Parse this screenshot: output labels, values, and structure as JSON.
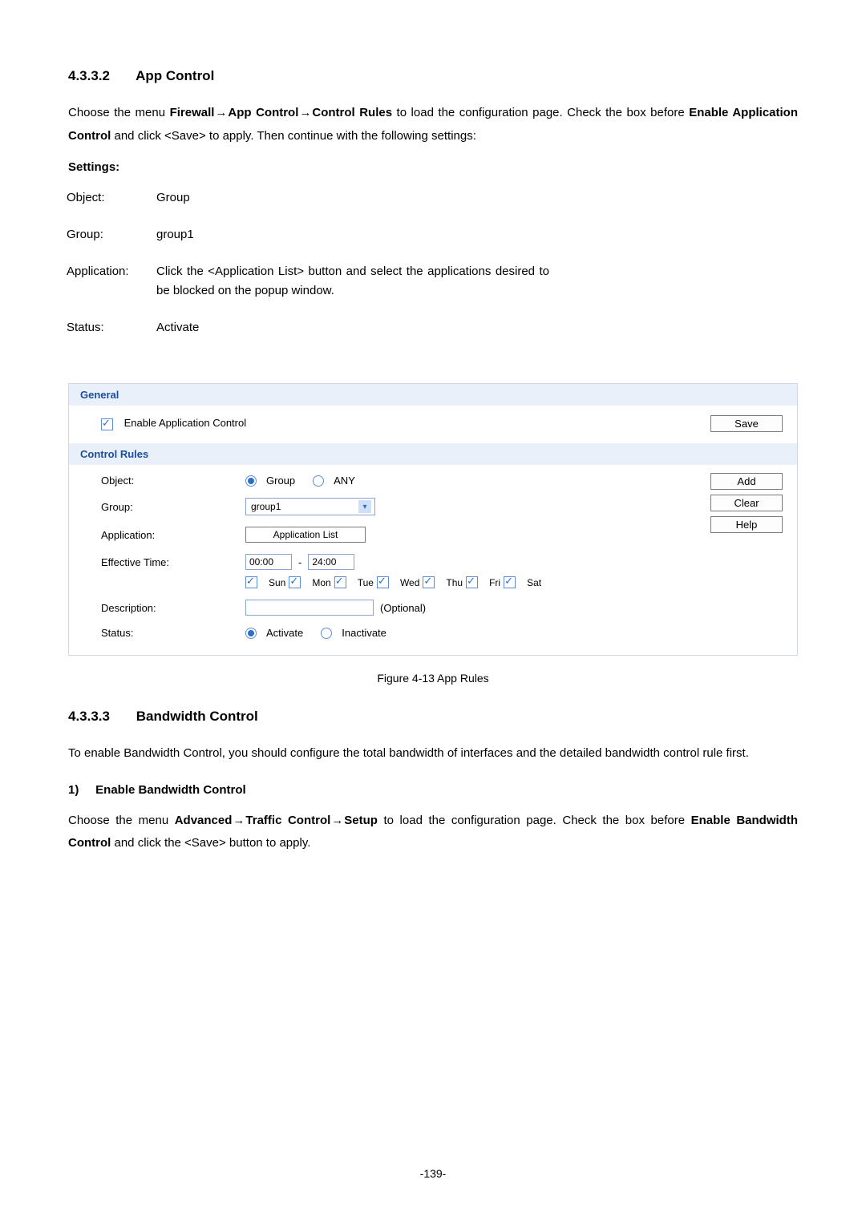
{
  "section1": {
    "number": "4.3.3.2",
    "title": "App Control",
    "intro_parts": {
      "p1": "Choose the menu ",
      "b1": "Firewall",
      "b2": "App Control",
      "b3": "Control Rules",
      "p2": " to load the configuration page. Check the box before ",
      "b4": "Enable Application Control",
      "p3": " and click <Save> to apply. Then continue with the following settings:"
    },
    "settings_heading": "Settings:",
    "settings": {
      "object_label": "Object:",
      "object_value": "Group",
      "group_label": "Group:",
      "group_value": "group1",
      "application_label": "Application:",
      "application_value": "Click the <Application List> button and select the applications desired to be blocked on the popup window.",
      "status_label": "Status:",
      "status_value": "Activate"
    }
  },
  "panel": {
    "general_header": "General",
    "enable_label": "Enable Application Control",
    "save_btn": "Save",
    "rules_header": "Control Rules",
    "object_label": "Object:",
    "object_opt1": "Group",
    "object_opt2": "ANY",
    "group_label": "Group:",
    "group_selected": "group1",
    "application_label": "Application:",
    "application_btn": "Application List",
    "effective_label": "Effective Time:",
    "time_from": "00:00",
    "time_dash": "-",
    "time_to": "24:00",
    "days": {
      "sun": "Sun",
      "mon": "Mon",
      "tue": "Tue",
      "wed": "Wed",
      "thu": "Thu",
      "fri": "Fri",
      "sat": "Sat"
    },
    "description_label": "Description:",
    "description_placeholder": "(Optional)",
    "status_label": "Status:",
    "status_opt1": "Activate",
    "status_opt2": "Inactivate",
    "btn_add": "Add",
    "btn_clear": "Clear",
    "btn_help": "Help"
  },
  "figure_caption": "Figure 4-13 App Rules",
  "section2": {
    "number": "4.3.3.3",
    "title": "Bandwidth Control",
    "intro": "To enable Bandwidth Control, you should configure the total bandwidth of interfaces and the detailed bandwidth control rule first.",
    "sub_num": "1)",
    "sub_title": "Enable Bandwidth Control",
    "para_parts": {
      "p1": "Choose the menu ",
      "b1": "Advanced",
      "b2": "Traffic Control",
      "b3": "Setup",
      "p2": " to load the configuration page. Check the box before ",
      "b4": "Enable Bandwidth Control",
      "p3": " and click the <Save> button to apply."
    }
  },
  "page_number": "-139-",
  "arrow_char": "→"
}
